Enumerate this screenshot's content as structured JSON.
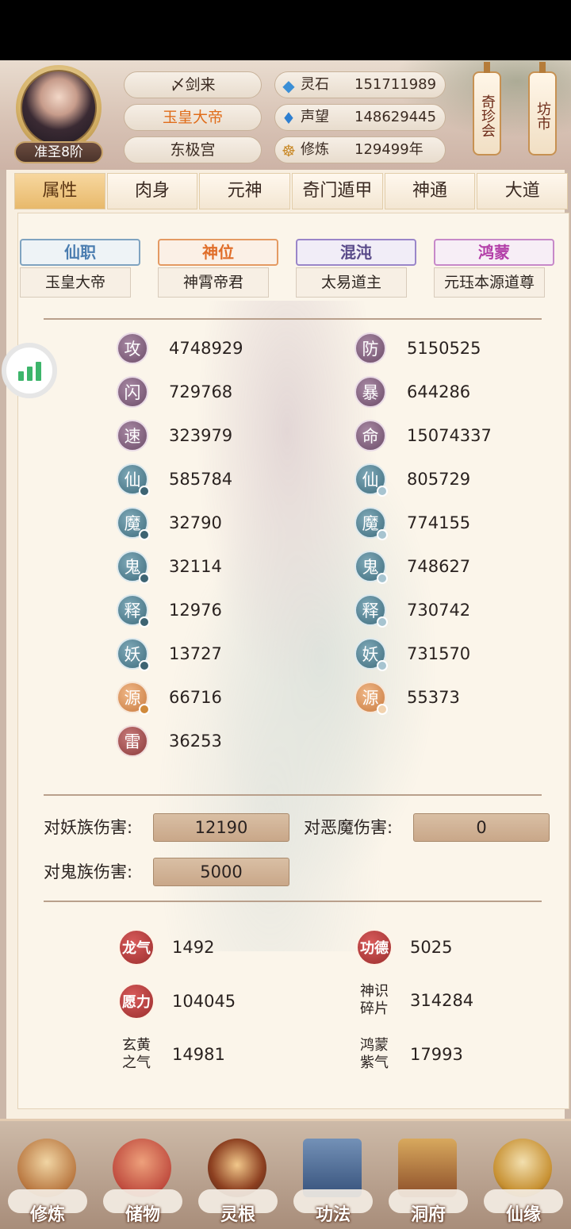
{
  "player": {
    "rank": "准圣8阶",
    "name": "〆剑来",
    "title": "玉皇大帝",
    "palace": "东极宫"
  },
  "resources": [
    {
      "label": "灵石",
      "value": "151711989",
      "icon": "spirit-stone-icon"
    },
    {
      "label": "声望",
      "value": "148629445",
      "icon": "prestige-icon"
    },
    {
      "label": "修炼",
      "value": "129499年",
      "icon": "cultivation-icon"
    }
  ],
  "shortcuts": {
    "treasure": "奇珍会",
    "market": "坊市"
  },
  "tabs": [
    "属性",
    "肉身",
    "元神",
    "奇门遁甲",
    "神通",
    "大道"
  ],
  "titles": [
    {
      "type": "仙职",
      "value": "玉皇大帝"
    },
    {
      "type": "神位",
      "value": "神霄帝君"
    },
    {
      "type": "混沌",
      "value": "太易道主"
    },
    {
      "type": "鸿蒙",
      "value": "元珏本源道尊"
    }
  ],
  "stats_left": [
    {
      "label": "攻",
      "value": "4748929"
    },
    {
      "label": "闪",
      "value": "729768"
    },
    {
      "label": "速",
      "value": "323979"
    },
    {
      "label": "仙",
      "value": "585784"
    },
    {
      "label": "魔",
      "value": "32790"
    },
    {
      "label": "鬼",
      "value": "32114"
    },
    {
      "label": "释",
      "value": "12976"
    },
    {
      "label": "妖",
      "value": "13727"
    },
    {
      "label": "源",
      "value": "66716"
    },
    {
      "label": "雷",
      "value": "36253"
    }
  ],
  "stats_right": [
    {
      "label": "防",
      "value": "5150525"
    },
    {
      "label": "暴",
      "value": "644286"
    },
    {
      "label": "命",
      "value": "15074337"
    },
    {
      "label": "仙",
      "value": "805729"
    },
    {
      "label": "魔",
      "value": "774155"
    },
    {
      "label": "鬼",
      "value": "748627"
    },
    {
      "label": "释",
      "value": "730742"
    },
    {
      "label": "妖",
      "value": "731570"
    },
    {
      "label": "源",
      "value": "55373"
    }
  ],
  "damage": [
    {
      "label": "对妖族伤害:",
      "value": "12190"
    },
    {
      "label": "对恶魔伤害:",
      "value": "0"
    },
    {
      "label": "对鬼族伤害:",
      "value": "5000"
    }
  ],
  "energies": [
    {
      "label": "龙气",
      "value": "1492"
    },
    {
      "label": "功德",
      "value": "5025"
    },
    {
      "label": "愿力",
      "value": "104045"
    },
    {
      "label": "神识碎片",
      "value": "314284"
    },
    {
      "label": "玄黄之气",
      "value": "14981"
    },
    {
      "label": "鸿蒙紫气",
      "value": "17993"
    }
  ],
  "nav": [
    "修炼",
    "储物",
    "灵根",
    "功法",
    "洞府",
    "仙缘"
  ]
}
